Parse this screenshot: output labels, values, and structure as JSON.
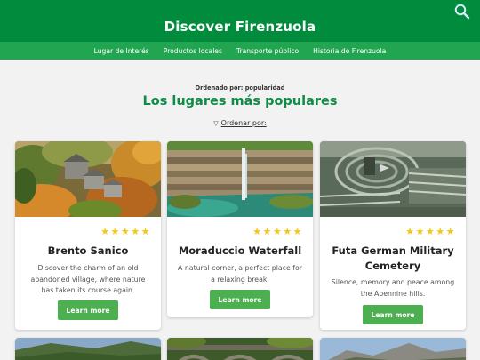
{
  "header": {
    "title": "Discover Firenzuola"
  },
  "nav": {
    "items": [
      {
        "label": "Lugar de Interés"
      },
      {
        "label": "Productos locales"
      },
      {
        "label": "Transporte público"
      },
      {
        "label": "Historia de Firenzuola"
      }
    ]
  },
  "sort": {
    "sorted_by": "Ordenado por: popularidad",
    "order_link": "Ordenar por:",
    "toggle_icon": "▽"
  },
  "section": {
    "title": "Los lugares más populares"
  },
  "cards": [
    {
      "title": "Brento Sanico",
      "rating": 5,
      "stars": "★★★★★",
      "description": "Discover the charm of an old abandoned village, where nature has taken its course again.",
      "button": "Learn more"
    },
    {
      "title": "Moraduccio Waterfall",
      "rating": 5,
      "stars": "★★★★★",
      "description": "A natural corner, a perfect place for a relaxing break.",
      "button": "Learn more"
    },
    {
      "title": "Futa German Military Cemetery",
      "rating": 5,
      "stars": "★★★★★",
      "description": "Silence, memory and peace among the Apennine hills.",
      "button": "Learn more"
    }
  ],
  "colors": {
    "header_bg": "#008c3c",
    "nav_bg": "#22a550",
    "title_green": "#0e8c43",
    "button_green": "#4caf50",
    "star": "#f5c518"
  },
  "icons": {
    "search": "search-icon",
    "sort_toggle": "triangle-down-icon"
  }
}
